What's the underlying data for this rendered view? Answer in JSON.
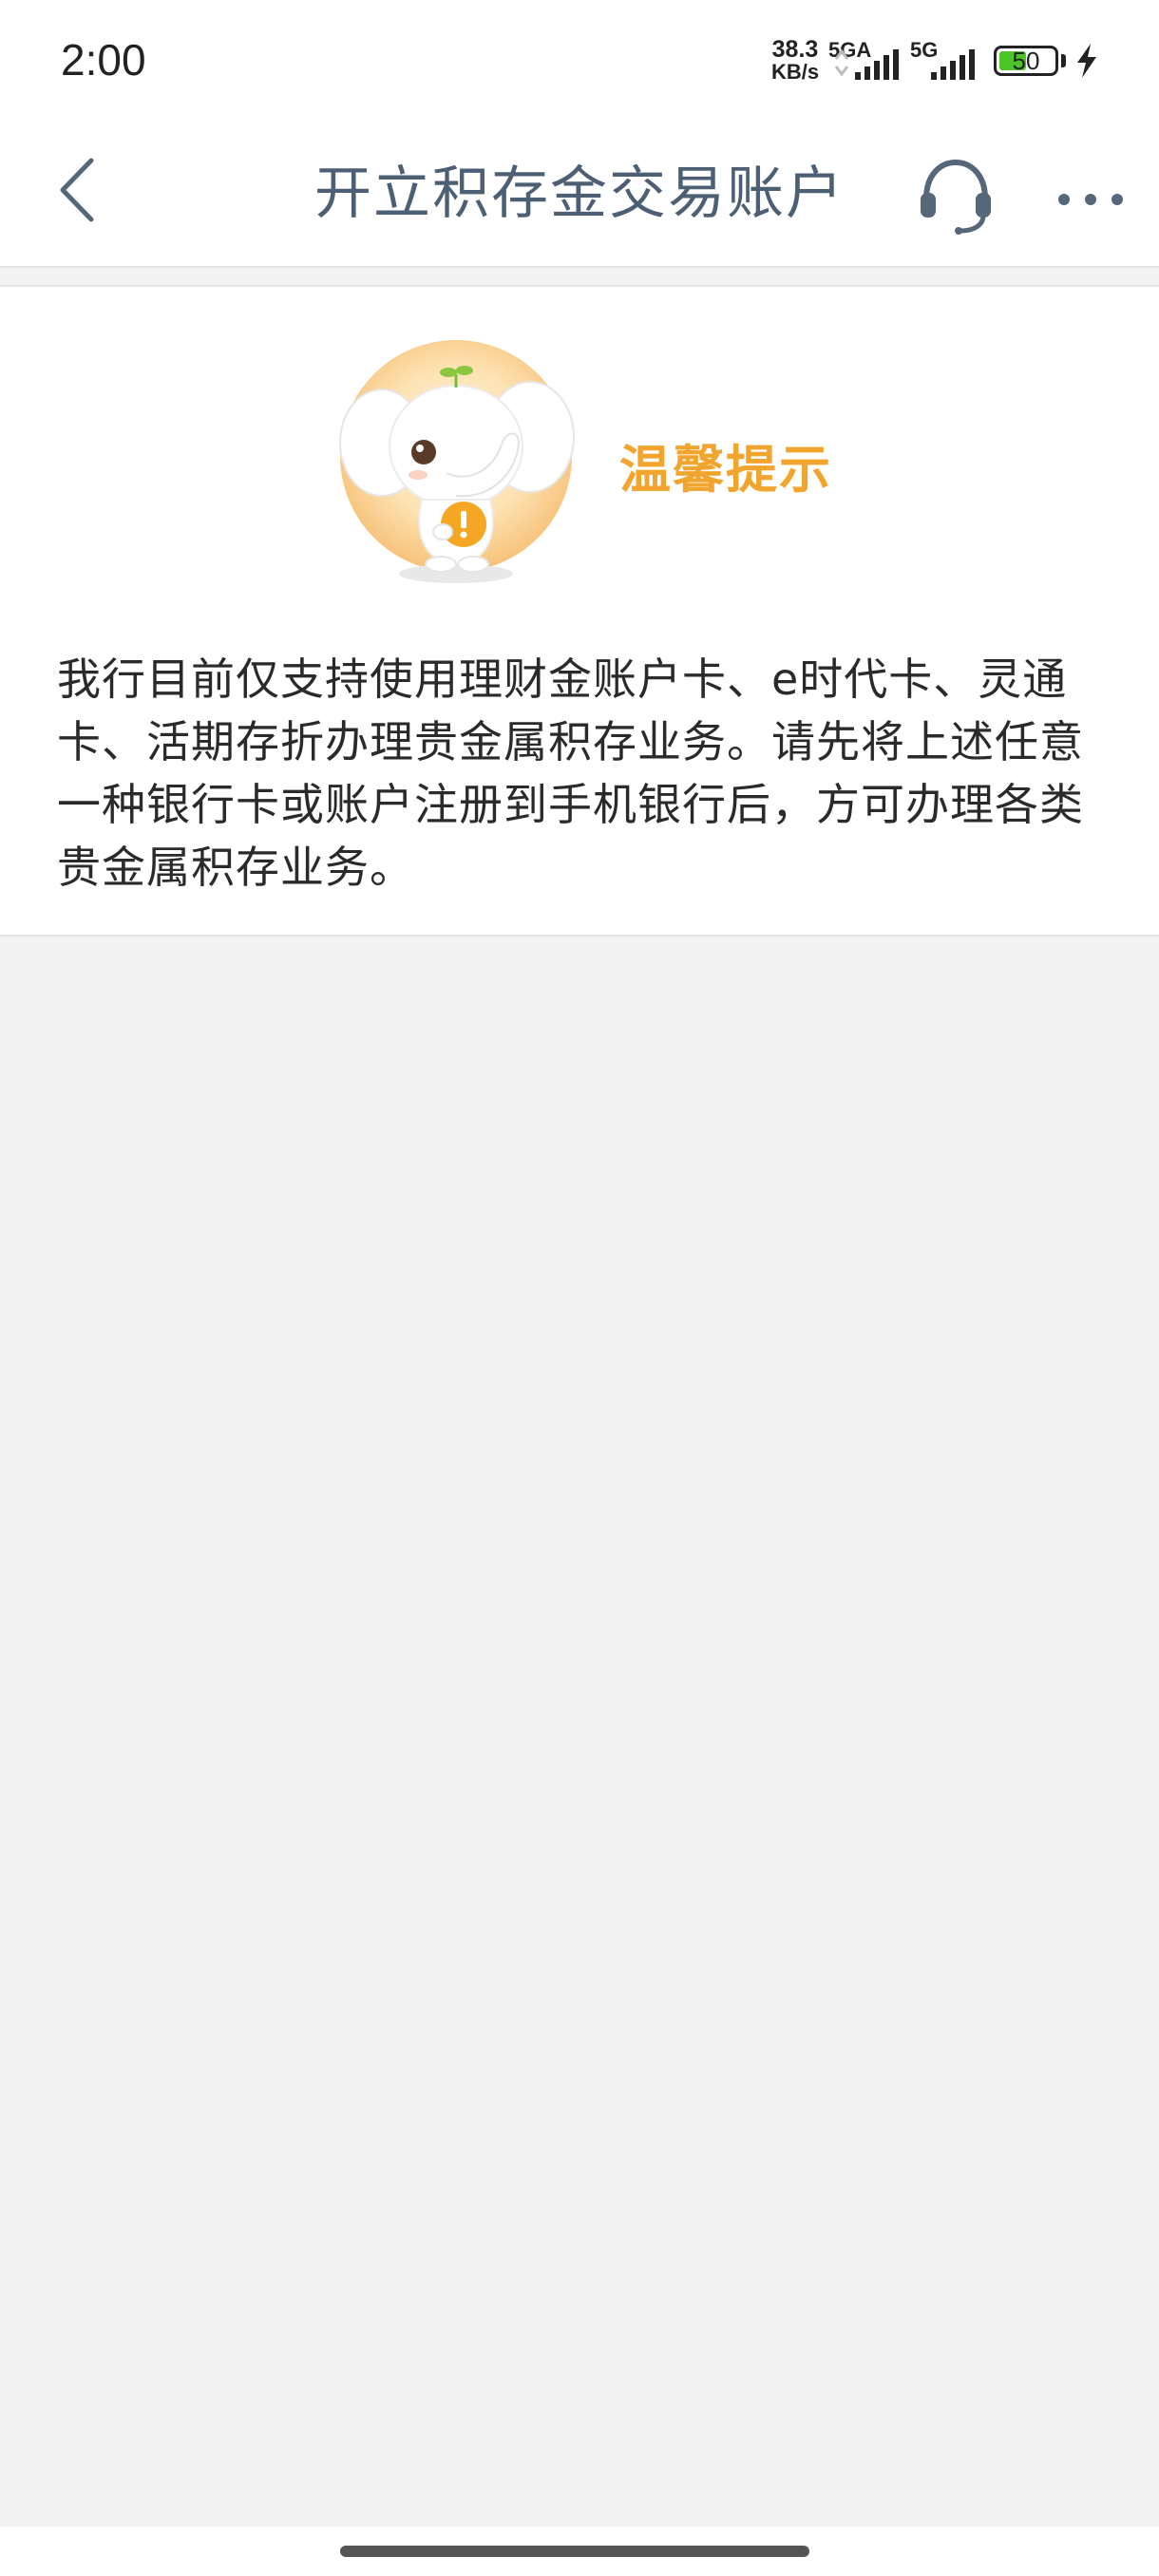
{
  "status_bar": {
    "time": "2:00",
    "net_speed_value": "38.3",
    "net_speed_unit": "KB/s",
    "sim1_label": "5GA",
    "sim2_label": "5G",
    "battery_level": "50",
    "battery_fraction": 0.5,
    "battery_color": "#4cc42a",
    "charging_icon": "lightning-bolt"
  },
  "nav": {
    "back_icon": "chevron-left",
    "title": "开立积存金交易账户",
    "service_icon": "headset",
    "more_icon": "ellipsis-horizontal",
    "title_color": "#4c5f74"
  },
  "notice": {
    "mascot": "elephant-mascot-with-alert",
    "title": "温馨提示",
    "title_color": "#f2a52e",
    "body": "我行目前仅支持使用理财金账户卡、e时代卡、灵通卡、活期存折办理贵金属积存业务。请先将上述任意一种银行卡或账户注册到手机银行后，方可办理各类贵金属积存业务。"
  }
}
